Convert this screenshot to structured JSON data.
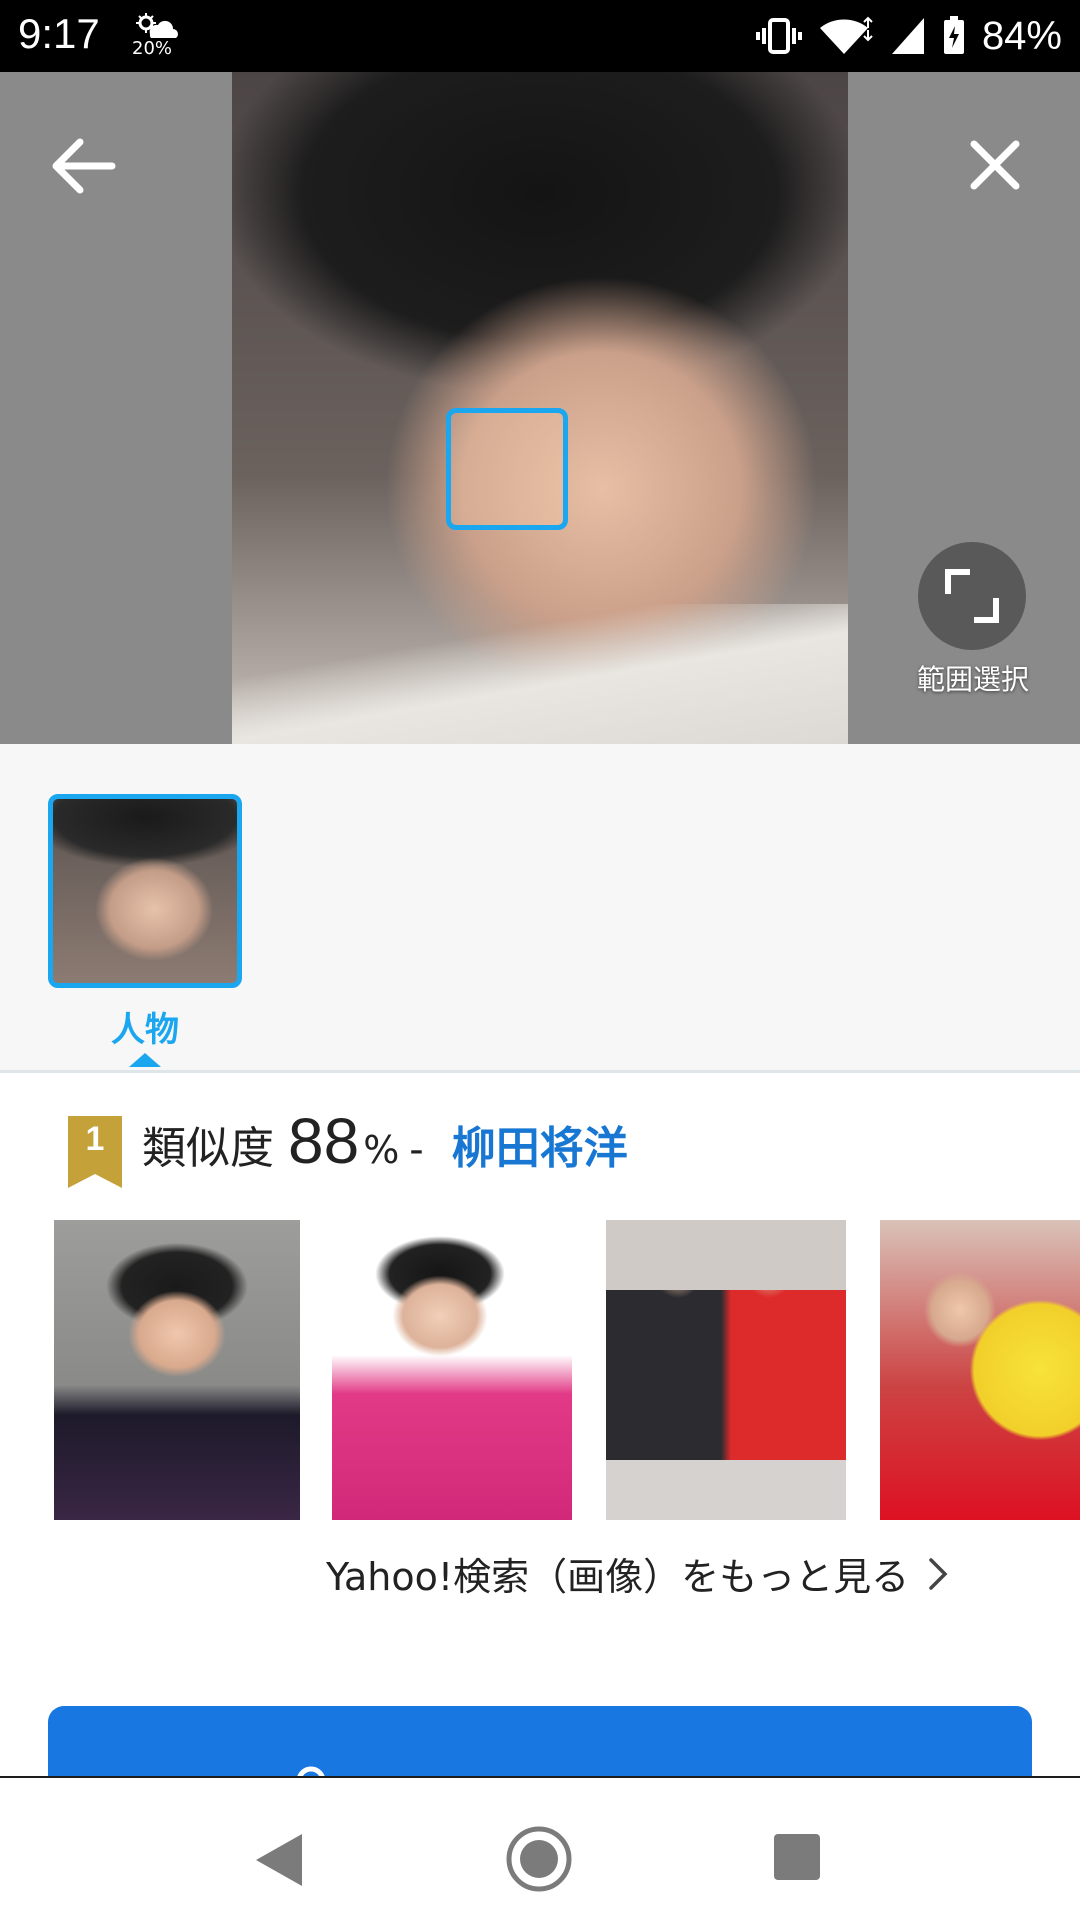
{
  "status_bar": {
    "time": "9:17",
    "weather_percent": "20%",
    "battery": "84%",
    "icons": [
      "weather-icon",
      "vibrate-icon",
      "wifi-icon",
      "signal-icon",
      "battery-icon"
    ]
  },
  "viewer": {
    "range_select_label": "範囲選択",
    "focus_box_color": "#1ba6f0"
  },
  "tray": {
    "category_label": "人物"
  },
  "result": {
    "rank": "1",
    "similarity_label": "類似度",
    "similarity_value": "88",
    "similarity_unit": "%",
    "dash": "-",
    "person_name": "柳田将洋",
    "more_link": "Yahoo!検索（画像）をもっと見る"
  },
  "colors": {
    "accent": "#1ba6f0",
    "name_link": "#1877d2",
    "primary_button": "#1877e0",
    "badge_gold": "#c5a13a"
  }
}
